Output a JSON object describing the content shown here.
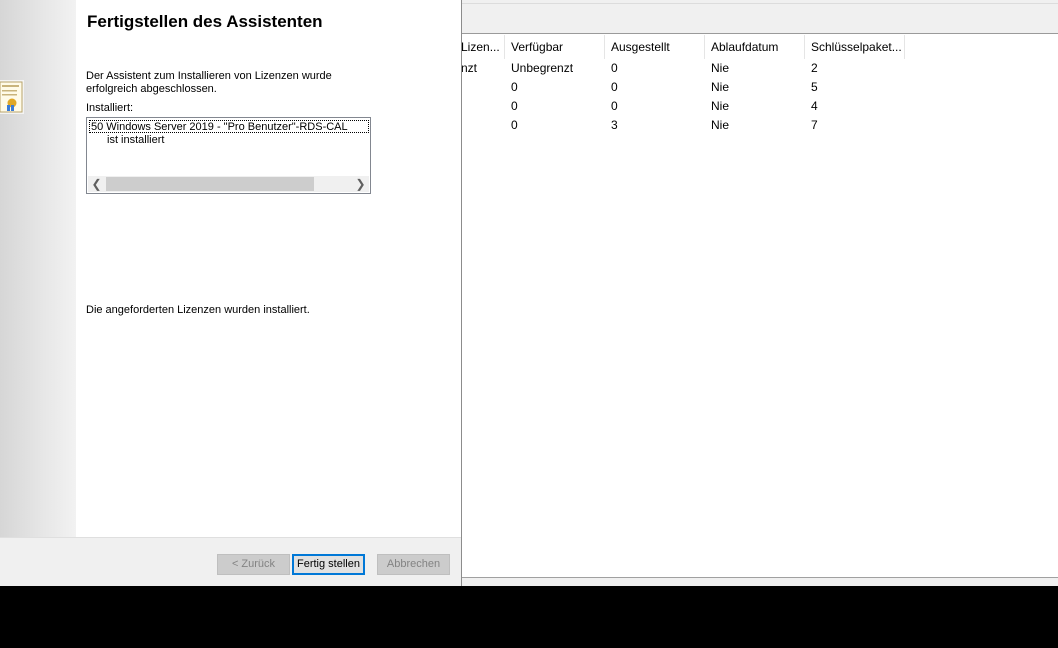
{
  "wizard": {
    "title": "Fertigstellen des Assistenten",
    "description": "Der Assistent zum Installieren von Lizenzen wurde erfolgreich abgeschlossen.",
    "installed_label": "Installiert:",
    "installed_items": [
      "50 Windows Server 2019 - \"Pro Benutzer\"-RDS-CAL",
      "ist installiert"
    ],
    "status_text": "Die angeforderten Lizenzen wurden installiert.",
    "buttons": {
      "back": "< Zurück",
      "finish": "Fertig stellen",
      "cancel": "Abbrechen"
    }
  },
  "listview": {
    "columns": [
      "Lizen...",
      "Verfügbar",
      "Ausgestellt",
      "Ablaufdatum",
      "Schlüsselpaket..."
    ],
    "rows": [
      [
        "nzt",
        "Unbegrenzt",
        "0",
        "Nie",
        "2"
      ],
      [
        "",
        "0",
        "0",
        "Nie",
        "5"
      ],
      [
        "",
        "0",
        "0",
        "Nie",
        "4"
      ],
      [
        "",
        "0",
        "3",
        "Nie",
        "7"
      ]
    ]
  },
  "colors": {
    "accent": "#0078d7",
    "dialog_bg": "#f0f0f0"
  },
  "icons": {
    "side_icon": "certificate-icon",
    "scroll_left": "chevron-left-icon",
    "scroll_right": "chevron-right-icon"
  }
}
